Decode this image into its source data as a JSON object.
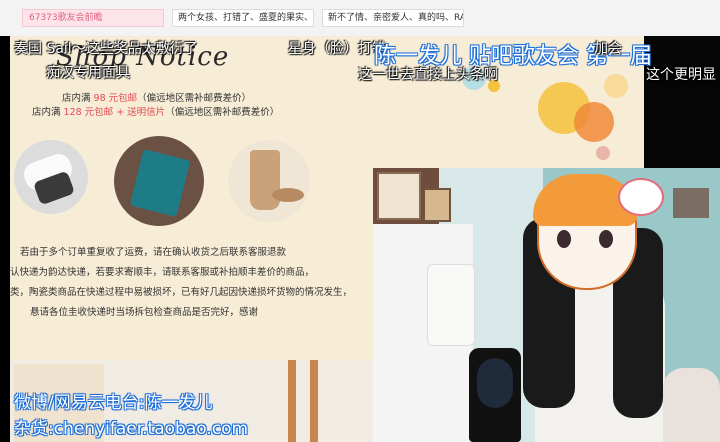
{
  "search": {
    "text": "67373歌友会前瞻"
  },
  "tags": [
    "两个女孩、打错了、盛夏的果实、终生…",
    "新不了情、亲密爱人、真的吗、RAIN"
  ],
  "poster": {
    "script_title": "Shop Notice",
    "lines": [
      "店内满 98 元包邮（偏远地区需补邮费差价）",
      "店内满 128 元包邮 + 送明信片（偏远地区需补邮费差价）"
    ],
    "price1": "98 元包邮",
    "price2": "128 元包邮 + 送明信片",
    "notice": [
      "若由于多个订单重复收了运费，请在确认收货之后联系客服退款",
      "认快递为韵达快递，若要求寄顺丰，请联系客服或补拍顺丰差价的商品，",
      "类，陶瓷类商品在快递过程中易被损坏，已有好几起因快递损坏货物的情况发生，",
      "悬请各位圭收快递时当场拆包检查商品是否完好，感谢"
    ]
  },
  "danmaku": [
    {
      "text": "奏国 Sail～这些奖品太敷衍了",
      "color": "#ffffff"
    },
    {
      "text": "痴汉专用面具",
      "color": "#ffffff"
    },
    {
      "text": "星身（脸）打错",
      "color": "#ffffff"
    },
    {
      "text": "陈一发儿 贴吧歌友会 第一届",
      "color": "#ffffff"
    },
    {
      "text": "加会",
      "color": "#ffffff"
    },
    {
      "text": "这一世去直接上头条啊",
      "color": "#ffffff"
    },
    {
      "text": "这个更明显",
      "color": "#ffffff"
    }
  ],
  "stream_info": {
    "weibo": "微博/网易云电台:陈一发儿",
    "shop": "杂货:chenyifaer.taobao.com"
  }
}
